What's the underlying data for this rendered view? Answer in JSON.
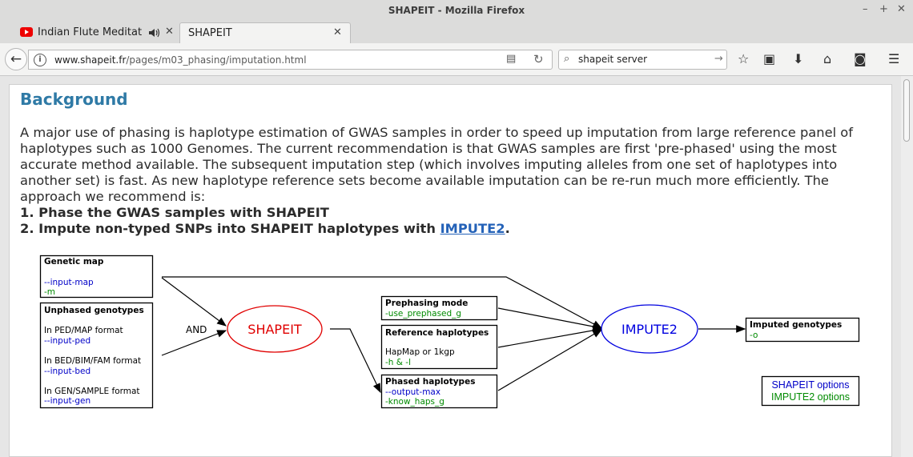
{
  "window": {
    "title": "SHAPEIT - Mozilla Firefox"
  },
  "tabs": [
    {
      "label": "Indian Flute Meditation",
      "audio_icon": "speaker-icon",
      "close": "✕"
    },
    {
      "label": "SHAPEIT",
      "close": "✕"
    }
  ],
  "navbar": {
    "url_host": "www.shapeit.fr",
    "url_path": "/pages/m03_phasing/imputation.html",
    "search_value": "shapeit server"
  },
  "page": {
    "heading": "Background",
    "paragraph": "A major use of phasing is haplotype estimation of GWAS samples in order to speed up imputation from large reference panel of haplotypes such as 1000 Genomes. The current recommendation is that GWAS samples are first 'pre-phased' using the most accurate method available. The subsequent imputation step (which involves imputing alleles from one set of haplotypes into another set) is fast. As new haplotype reference sets become available imputation can be re-run much more efficiently. The approach we recommend is:",
    "step1": "1. Phase the GWAS samples with SHAPEIT",
    "step2_prefix": "2. Impute non-typed SNPs into SHAPEIT haplotypes with ",
    "step2_link": "IMPUTE2",
    "step2_suffix": "."
  },
  "diagram": {
    "genetic_map": {
      "title": "Genetic map",
      "opt1": "--input-map",
      "opt2": "-m"
    },
    "unphased": {
      "title": "Unphased genotypes",
      "ped_label": "In PED/MAP format",
      "ped_opt": "--input-ped",
      "bed_label": "In BED/BIM/FAM format",
      "bed_opt": "--input-bed",
      "gen_label": "In GEN/SAMPLE format",
      "gen_opt": "--input-gen"
    },
    "and_label": "AND",
    "shapeit_node": "SHAPEIT",
    "prephasing": {
      "title": "Prephasing mode",
      "opt": "-use_prephased_g"
    },
    "reference": {
      "title": "Reference haplotypes",
      "text": "HapMap or 1kgp",
      "opt": "-h & -l"
    },
    "phased": {
      "title": "Phased haplotypes",
      "opt1": "--output-max",
      "opt2": "-know_haps_g"
    },
    "impute2_node": "IMPUTE2",
    "imputed": {
      "title": "Imputed genotypes",
      "opt": "-o"
    },
    "legend": {
      "shapeit": "SHAPEIT options",
      "impute2": "IMPUTE2 options"
    },
    "colors": {
      "shapeit": "#e00000",
      "impute2": "#0000e0",
      "shapeit_opt": "#0000c8",
      "impute2_opt": "#008a00"
    }
  }
}
